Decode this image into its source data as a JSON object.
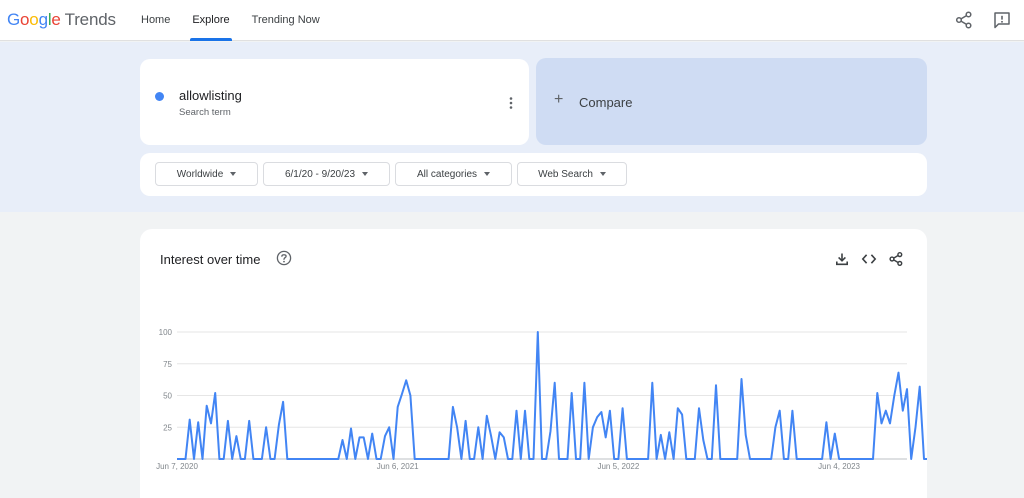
{
  "app": {
    "logo_letters": [
      "G",
      "o",
      "o",
      "g",
      "l",
      "e"
    ],
    "logo_product": "Trends"
  },
  "nav": {
    "items": [
      {
        "label": "Home",
        "active": false
      },
      {
        "label": "Explore",
        "active": true
      },
      {
        "label": "Trending Now",
        "active": false
      }
    ]
  },
  "header_actions": {
    "icons": [
      "share-icon",
      "feedback-icon"
    ]
  },
  "search": {
    "term": "allowlisting",
    "term_subtitle": "Search term",
    "term_color": "#4285f4",
    "compare_label": "Compare"
  },
  "filters": {
    "region": "Worldwide",
    "date_range": "6/1/20 - 9/20/23",
    "category": "All categories",
    "search_type": "Web Search"
  },
  "interest_panel": {
    "title": "Interest over time",
    "icons": [
      "help-icon",
      "download-icon",
      "embed-icon",
      "share-icon"
    ]
  },
  "colors": {
    "accent": "#1a73e8",
    "series": "#4285f4",
    "compare_bg": "#cfdcf3",
    "band_bg": "#e8eef9"
  },
  "chart_data": {
    "type": "line",
    "ylim": [
      0,
      100
    ],
    "y_ticks": [
      100,
      75,
      50,
      25
    ],
    "x_ticks": [
      {
        "label": "Jun 7, 2020",
        "week": 0
      },
      {
        "label": "Jun 6, 2021",
        "week": 52
      },
      {
        "label": "Jun 5, 2022",
        "week": 104
      },
      {
        "label": "Jun 4, 2023",
        "week": 156
      }
    ],
    "week_count": 173,
    "series": [
      {
        "values": [
          0,
          0,
          0,
          31,
          0,
          29,
          0,
          42,
          28,
          52,
          0,
          0,
          30,
          0,
          18,
          0,
          0,
          30,
          0,
          0,
          0,
          25,
          0,
          0,
          27,
          45,
          0,
          0,
          0,
          0,
          0,
          0,
          0,
          0,
          0,
          0,
          0,
          0,
          0,
          15,
          0,
          24,
          0,
          17,
          17,
          0,
          20,
          0,
          0,
          18,
          25,
          0,
          41,
          51,
          62,
          50,
          0,
          0,
          0,
          0,
          0,
          0,
          0,
          0,
          0,
          41,
          25,
          0,
          30,
          0,
          0,
          25,
          0,
          34,
          18,
          0,
          21,
          17,
          0,
          0,
          38,
          0,
          38,
          0,
          0,
          100,
          0,
          0,
          22,
          60,
          0,
          0,
          0,
          52,
          0,
          0,
          60,
          0,
          25,
          33,
          37,
          17,
          38,
          0,
          0,
          40,
          0,
          0,
          0,
          0,
          0,
          0,
          60,
          0,
          19,
          0,
          21,
          0,
          40,
          35,
          0,
          0,
          0,
          40,
          15,
          0,
          0,
          58,
          0,
          0,
          0,
          0,
          0,
          63,
          19,
          0,
          0,
          0,
          0,
          0,
          0,
          25,
          38,
          0,
          0,
          38,
          0,
          0,
          0,
          0,
          0,
          0,
          0,
          29,
          0,
          20,
          0,
          0,
          0,
          0,
          0,
          0,
          0,
          0,
          0,
          52,
          28,
          38,
          28,
          50,
          68,
          38,
          55,
          0,
          25,
          57,
          0,
          0
        ]
      }
    ]
  }
}
